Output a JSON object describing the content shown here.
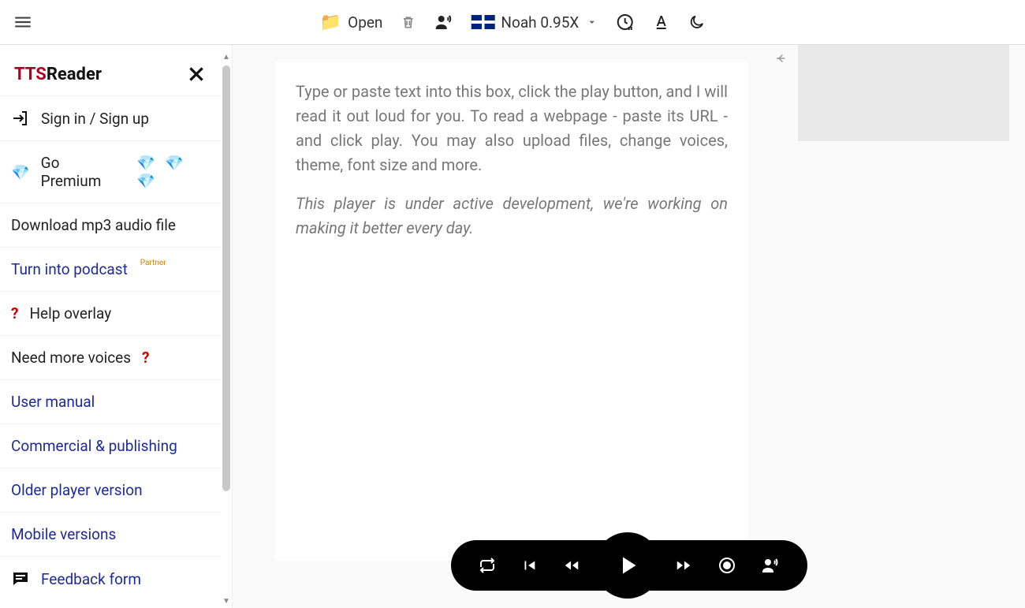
{
  "brand": {
    "part1": "TTS",
    "part2": "Reader"
  },
  "topbar": {
    "open_label": "Open",
    "voice_label": "Noah 0.95X"
  },
  "sidebar": {
    "signin": "Sign in / Sign up",
    "premium": "Go Premium",
    "gems": "💎 💎 💎",
    "download": "Download mp3 audio file",
    "podcast": "Turn into podcast",
    "podcast_badge": "Partner",
    "help_overlay": "Help overlay",
    "need_voices": "Need more voices",
    "user_manual": "User manual",
    "commercial": "Commercial & publishing",
    "older_player": "Older player version",
    "mobile": "Mobile versions",
    "feedback": "Feedback form"
  },
  "editor": {
    "placeholder_p1": "Type or paste text into this box, click the play button, and I will read it out loud for you. To read a webpage - paste its URL - and click play. You may also upload files, change voices, theme, font size and more.",
    "placeholder_p2": "This player is under active development, we're working on making it better every day."
  }
}
